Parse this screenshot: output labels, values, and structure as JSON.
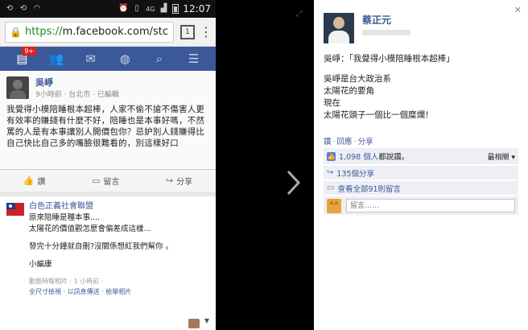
{
  "phone": {
    "status": {
      "network": "4G",
      "time": "12:07"
    },
    "browser": {
      "url_scheme": "https://",
      "url_rest": "m.facebook.com/stc",
      "tab_count": "1"
    },
    "fbnav": {
      "badge": "9+"
    },
    "post1": {
      "author": "吳崢",
      "meta": "9小時前 · 台北市 · 已編輯",
      "text": "我覺得小模陪睡根本超棒，人家不偷不搶不傷害人更有效率的賺錢有什麼不好，陪睡也是本事好嗎，不然罵的人是有本事讓別人開價包你？忌妒別人錢賺得比自己快比自己多的嘴臉很難看的，別這樣好口",
      "like_label": "讚",
      "comment_label": "留言",
      "share_label": "分享"
    },
    "post2": {
      "page_name": "白色正義社會聯盟",
      "lines": [
        "原來陪睡是種本事....",
        "太陽花的價值觀怎麼會偏差成這樣..."
      ],
      "line2": "發完十分鐘就自刪?沒關係想紅我們幫你 。",
      "sign": "小編康",
      "meta": "動態時報相片 · 1 小時前 ·",
      "links": "全尺寸檢視 · 以訊息傳送 · 檢舉相片"
    }
  },
  "panel": {
    "name": "蔡正元",
    "body_line1": "吳崢：「我覺得小模陪睡根本超棒」",
    "body_lines": [
      "吳崢是台大政治系",
      "太陽花的要角",
      "現在",
      "太陽花頭子一個比一個糜爛！"
    ],
    "actions": {
      "like": "讚",
      "reply": "回應",
      "share": "分享"
    },
    "likes": {
      "count": "1,098 個人",
      "tail": "都說讚。",
      "sort": "最相關"
    },
    "shares": "135個分享",
    "comments": "查看全部91則留言",
    "comment_placeholder": "留言……"
  }
}
